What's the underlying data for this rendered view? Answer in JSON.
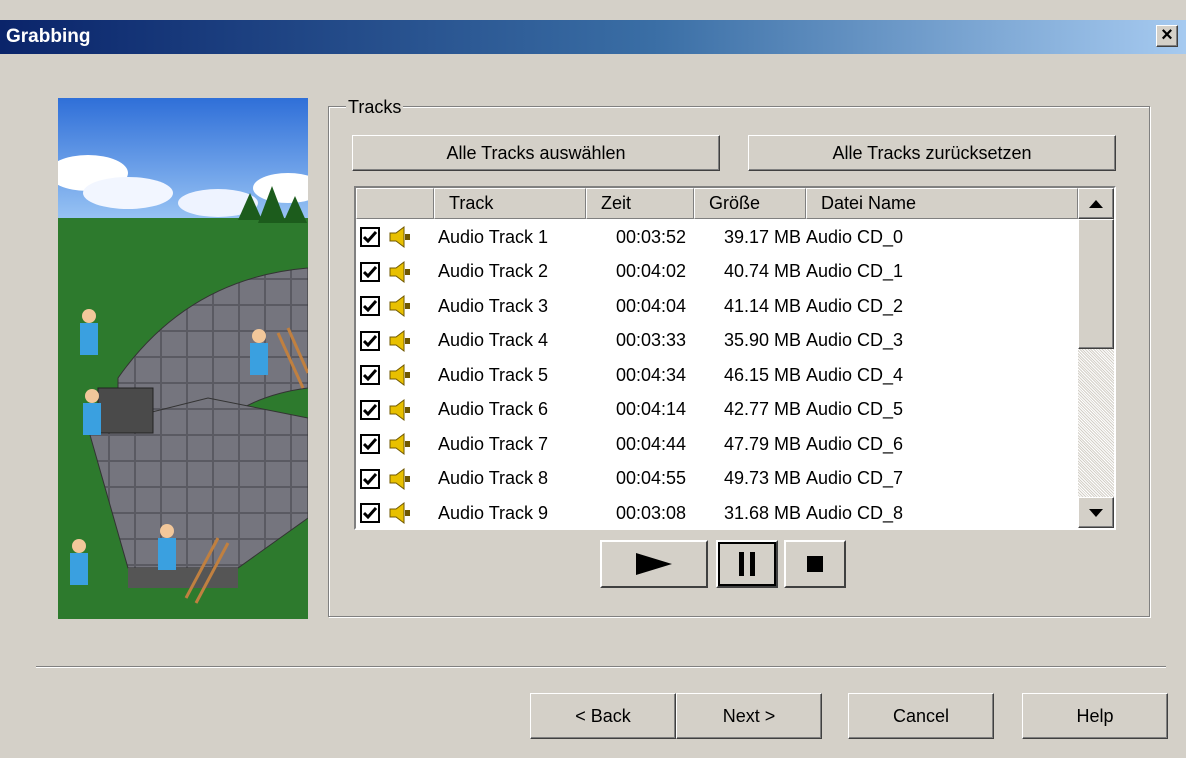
{
  "window": {
    "title": "Grabbing",
    "close_label": "×"
  },
  "tracks_group": {
    "label": "Tracks",
    "select_all_label": "Alle Tracks auswählen",
    "reset_all_label": "Alle Tracks zurücksetzen"
  },
  "list": {
    "columns": [
      "",
      "Track",
      "Zeit",
      "Größe",
      "Datei Name"
    ],
    "rows": [
      {
        "checked": true,
        "track": "Audio Track 1",
        "zeit": "00:03:52",
        "size": "39.17 MB",
        "name": "Audio CD_0"
      },
      {
        "checked": true,
        "track": "Audio Track 2",
        "zeit": "00:04:02",
        "size": "40.74 MB",
        "name": "Audio CD_1"
      },
      {
        "checked": true,
        "track": "Audio Track 3",
        "zeit": "00:04:04",
        "size": "41.14 MB",
        "name": "Audio CD_2"
      },
      {
        "checked": true,
        "track": "Audio Track 4",
        "zeit": "00:03:33",
        "size": "35.90 MB",
        "name": "Audio CD_3"
      },
      {
        "checked": true,
        "track": "Audio Track 5",
        "zeit": "00:04:34",
        "size": "46.15 MB",
        "name": "Audio CD_4"
      },
      {
        "checked": true,
        "track": "Audio Track 6",
        "zeit": "00:04:14",
        "size": "42.77 MB",
        "name": "Audio CD_5"
      },
      {
        "checked": true,
        "track": "Audio Track 7",
        "zeit": "00:04:44",
        "size": "47.79 MB",
        "name": "Audio CD_6"
      },
      {
        "checked": true,
        "track": "Audio Track 8",
        "zeit": "00:04:55",
        "size": "49.73 MB",
        "name": "Audio CD_7"
      },
      {
        "checked": true,
        "track": "Audio Track 9",
        "zeit": "00:03:08",
        "size": "31.68 MB",
        "name": "Audio CD_8"
      }
    ]
  },
  "player": {
    "play_icon": "play-icon",
    "pause_icon": "pause-icon",
    "stop_icon": "stop-icon"
  },
  "footer": {
    "back_label": "< Back",
    "next_label": "Next >",
    "cancel_label": "Cancel",
    "help_label": "Help"
  },
  "colors": {
    "face": "#d4d0c8",
    "title_start": "#0a246a",
    "title_end": "#a6caf0",
    "speaker": "#e8c000"
  }
}
